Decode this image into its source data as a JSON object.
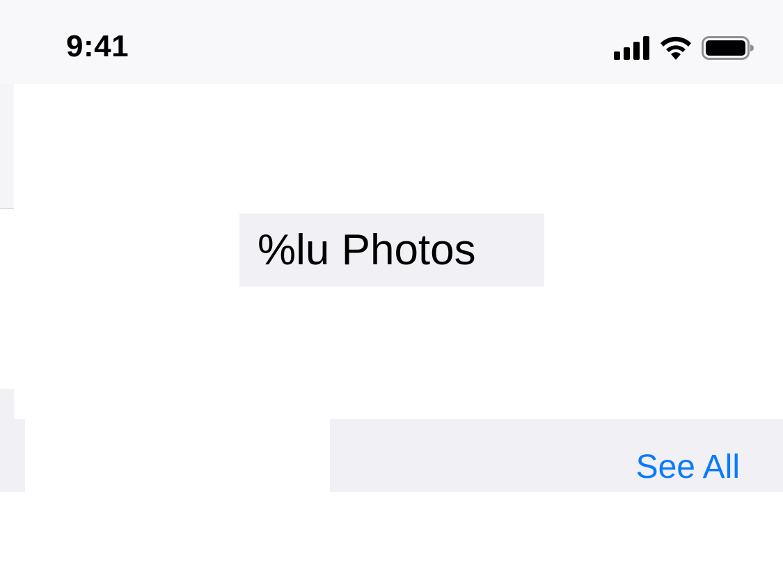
{
  "status_bar": {
    "time": "9:41",
    "icons": [
      "signal-icon",
      "wifi-icon",
      "battery-icon"
    ]
  },
  "photos_header": {
    "count_label": "%lu Photos"
  },
  "section": {
    "see_all_label": "See All"
  },
  "colors": {
    "accent": "#0a7aff",
    "header_background": "#f8f8fa",
    "group_background": "#f1f1f5"
  }
}
